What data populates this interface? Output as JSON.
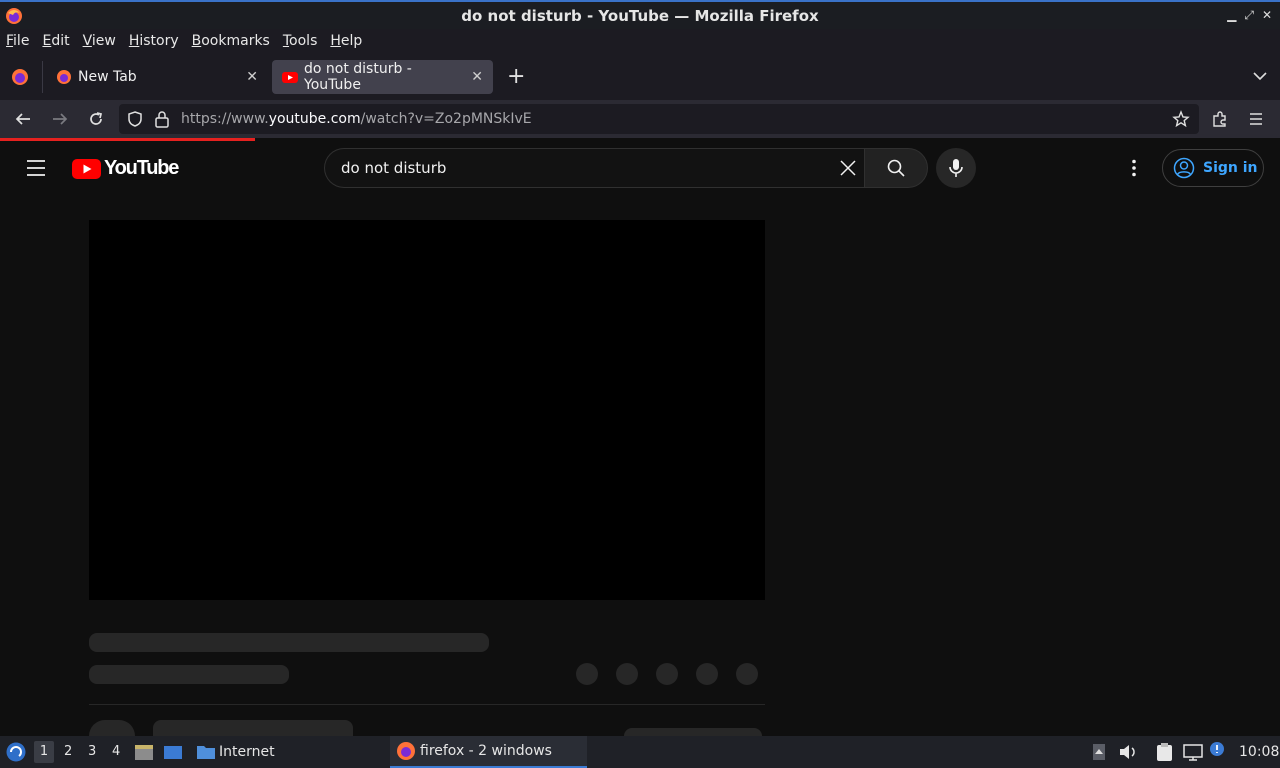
{
  "window": {
    "title": "do not disturb - YouTube — Mozilla Firefox"
  },
  "menubar": {
    "items": [
      "File",
      "Edit",
      "View",
      "History",
      "Bookmarks",
      "Tools",
      "Help"
    ]
  },
  "tabs": [
    {
      "label": "New Tab",
      "favicon": "firefox-icon",
      "active": false
    },
    {
      "label": "do not disturb - YouTube",
      "favicon": "youtube-icon",
      "active": true
    }
  ],
  "navbar": {
    "url_prefix": "https://www.",
    "url_domain": "youtube.com",
    "url_path": "/watch?v=Zo2pMNSkIvE"
  },
  "youtube": {
    "logo_text": "YouTube",
    "search_value": "do not disturb",
    "sign_in_label": "Sign in"
  },
  "taskbar": {
    "workspaces": [
      "1",
      "2",
      "3",
      "4"
    ],
    "internet_label": "Internet",
    "firefox_task_label": "firefox - 2 windows",
    "clock": "10:08"
  },
  "colors": {
    "youtube_red": "#ff0000",
    "link_blue": "#3ea6ff",
    "progress_red": "#e5211f"
  }
}
